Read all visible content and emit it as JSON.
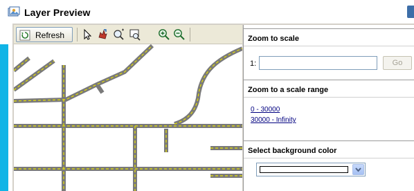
{
  "header": {
    "title": "Layer Preview"
  },
  "toolbar": {
    "refresh_label": "Refresh",
    "tools": [
      "select-arrow-icon",
      "pan-icon",
      "zoom-region-icon",
      "zoom-extents-icon",
      "zoom-in-icon",
      "zoom-out-icon"
    ]
  },
  "panel": {
    "zoom_to_scale": {
      "heading": "Zoom to scale",
      "prefix": "1:",
      "value": "",
      "go_label": "Go"
    },
    "scale_range": {
      "heading": "Zoom to a scale range",
      "ranges": [
        "0 - 30000",
        "30000 - Infinity"
      ]
    },
    "background": {
      "heading": "Select background color",
      "selected_color": "#ffffff"
    }
  },
  "colors": {
    "road_fill": "#7a7a7a",
    "road_dash": "#e8e000",
    "accent_strip": "#10b4e6"
  }
}
